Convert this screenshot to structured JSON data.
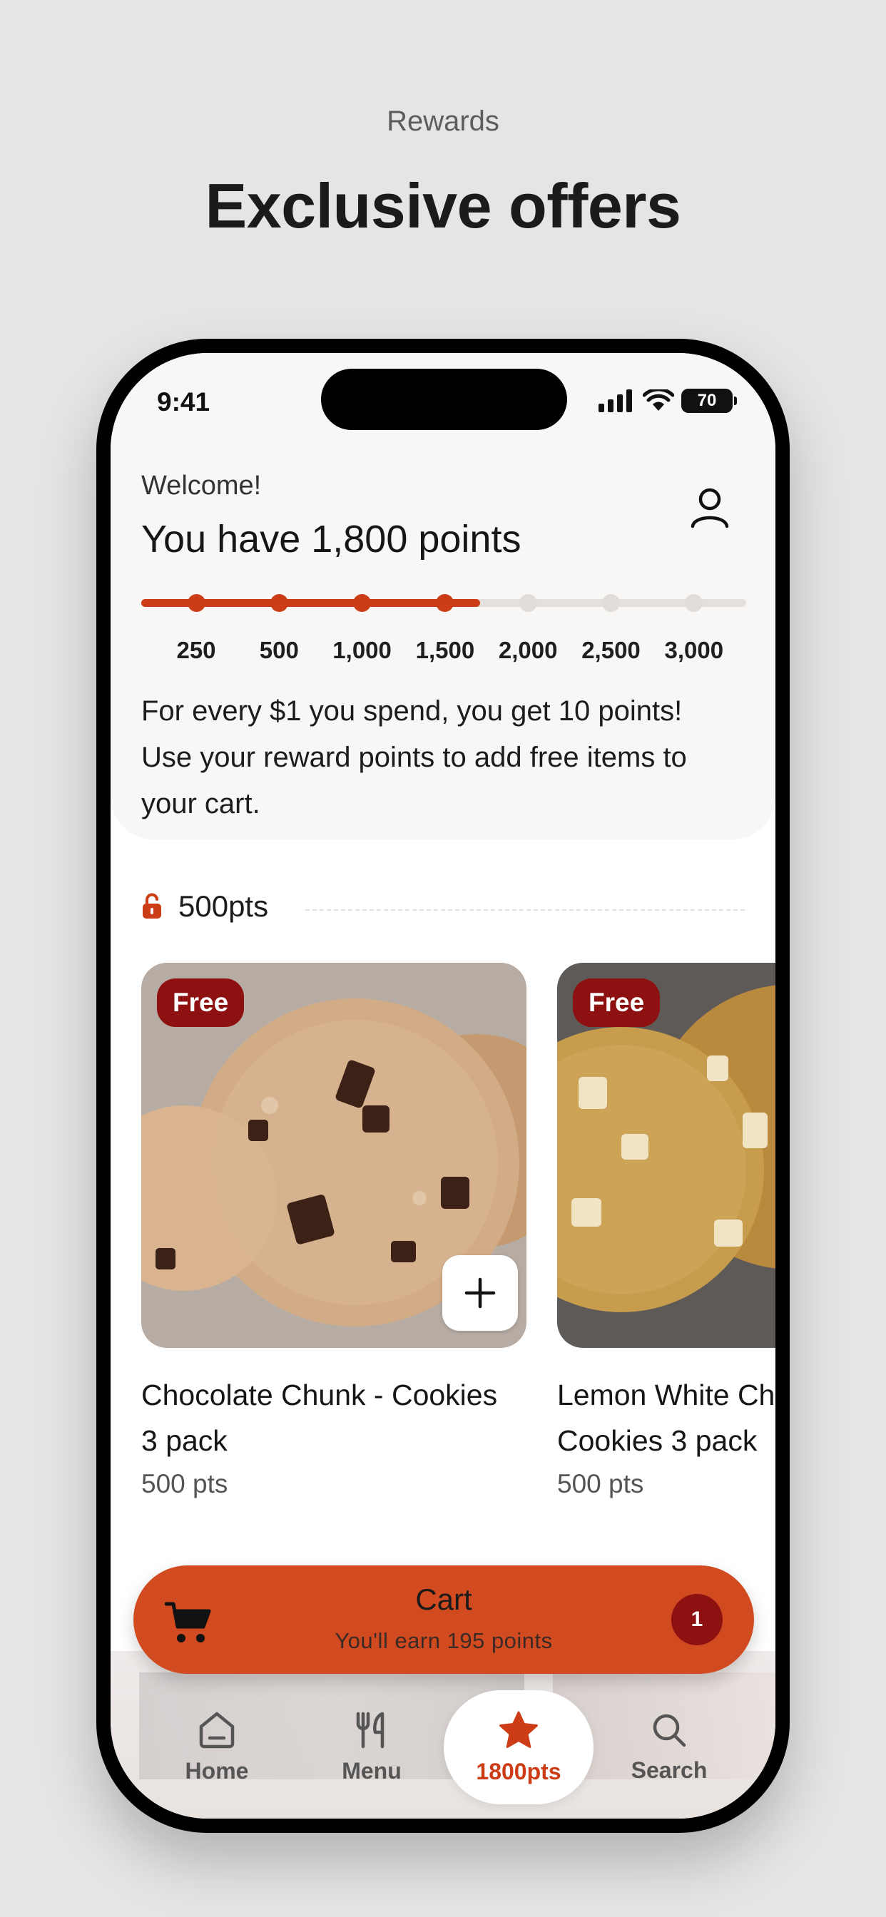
{
  "header": {
    "kicker": "Rewards",
    "headline": "Exclusive offers"
  },
  "status_bar": {
    "time": "9:41",
    "battery": "70"
  },
  "rewards": {
    "welcome": "Welcome!",
    "points_title": "You have 1,800 points",
    "current_points": 1800,
    "progress_fraction": 0.56,
    "milestones": [
      {
        "label": "250",
        "reached": true
      },
      {
        "label": "500",
        "reached": true
      },
      {
        "label": "1,000",
        "reached": true
      },
      {
        "label": "1,500",
        "reached": true
      },
      {
        "label": "2,000",
        "reached": false
      },
      {
        "label": "2,500",
        "reached": false
      },
      {
        "label": "3,000",
        "reached": false
      }
    ],
    "info": "For every $1 you spend, you get 10 points! Use your reward points to add free items to your cart."
  },
  "tier": {
    "label": "500pts"
  },
  "products": [
    {
      "badge": "Free",
      "name_line1": "Chocolate Chunk - Cookies",
      "name_line2": "3 pack",
      "points": "500 pts"
    },
    {
      "badge": "Free",
      "name_line1": "Lemon White Ch",
      "name_line2": "Cookies 3 pack",
      "points": "500 pts"
    }
  ],
  "cart": {
    "title": "Cart",
    "subtitle": "You'll earn 195 points",
    "count": "1"
  },
  "tabs": [
    {
      "label": "Home",
      "icon": "home-icon"
    },
    {
      "label": "Menu",
      "icon": "utensils-icon"
    },
    {
      "label": "1800pts",
      "icon": "star-icon",
      "active": true
    },
    {
      "label": "Search",
      "icon": "search-icon"
    }
  ],
  "colors": {
    "accent": "#cc3d17",
    "cart": "#d24a1f",
    "badge": "#8e1111",
    "background": "#e5e5e6"
  }
}
